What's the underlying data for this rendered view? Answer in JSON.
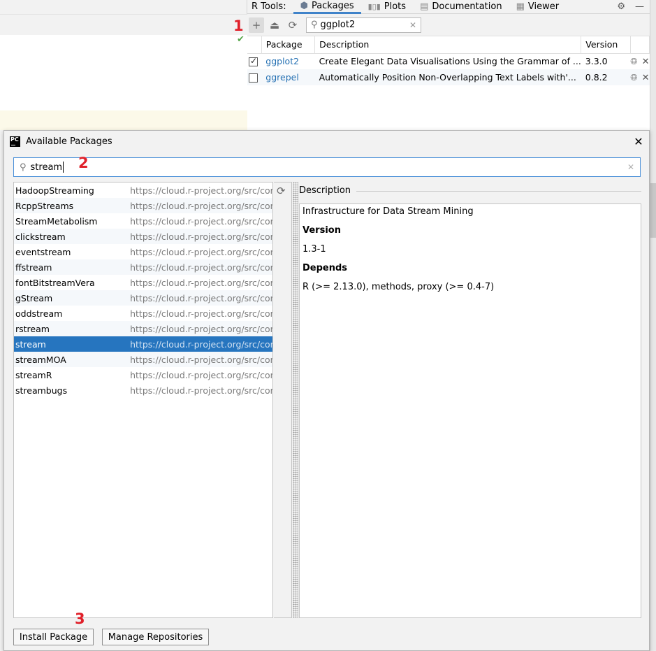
{
  "rtools": {
    "title": "R Tools:",
    "tabs": [
      {
        "label": "Packages",
        "icon": "package-icon"
      },
      {
        "label": "Plots",
        "icon": "bar-chart-icon"
      },
      {
        "label": "Documentation",
        "icon": "document-icon"
      },
      {
        "label": "Viewer",
        "icon": "grid-icon"
      }
    ],
    "search_value": "ggplot2",
    "columns": [
      "Package",
      "Description",
      "Version"
    ],
    "rows": [
      {
        "checked": true,
        "name": "ggplot2",
        "description": "Create Elegant Data Visualisations Using the Grammar of ...",
        "version": "3.3.0"
      },
      {
        "checked": false,
        "name": "ggrepel",
        "description": "Automatically Position Non-Overlapping Text Labels with'...",
        "version": "0.8.2"
      }
    ]
  },
  "dialog": {
    "title": "Available Packages",
    "search_value": "stream",
    "packages": [
      {
        "name": "HadoopStreaming",
        "url": "https://cloud.r-project.org/src/contrib"
      },
      {
        "name": "RcppStreams",
        "url": "https://cloud.r-project.org/src/contrib"
      },
      {
        "name": "StreamMetabolism",
        "url": "https://cloud.r-project.org/src/contrib"
      },
      {
        "name": "clickstream",
        "url": "https://cloud.r-project.org/src/contrib"
      },
      {
        "name": "eventstream",
        "url": "https://cloud.r-project.org/src/contrib"
      },
      {
        "name": "ffstream",
        "url": "https://cloud.r-project.org/src/contrib"
      },
      {
        "name": "fontBitstreamVera",
        "url": "https://cloud.r-project.org/src/contrib"
      },
      {
        "name": "gStream",
        "url": "https://cloud.r-project.org/src/contrib"
      },
      {
        "name": "oddstream",
        "url": "https://cloud.r-project.org/src/contrib"
      },
      {
        "name": "rstream",
        "url": "https://cloud.r-project.org/src/contrib"
      },
      {
        "name": "stream",
        "url": "https://cloud.r-project.org/src/contrib",
        "selected": true
      },
      {
        "name": "streamMOA",
        "url": "https://cloud.r-project.org/src/contrib"
      },
      {
        "name": "streamR",
        "url": "https://cloud.r-project.org/src/contrib"
      },
      {
        "name": "streambugs",
        "url": "https://cloud.r-project.org/src/contrib"
      }
    ],
    "description_title": "Description",
    "description": {
      "summary": "Infrastructure for Data Stream Mining",
      "version_label": "Version",
      "version": "1.3-1",
      "depends_label": "Depends",
      "depends": "R (>= 2.13.0), methods, proxy (>= 0.4-7)"
    },
    "install_button": "Install Package",
    "manage_button": "Manage Repositories"
  },
  "markers": [
    "1",
    "2",
    "3"
  ],
  "colors": {
    "accent": "#2675bf",
    "link": "#2470b3",
    "marker": "#e0202a",
    "focus_border": "#4a90d9"
  }
}
